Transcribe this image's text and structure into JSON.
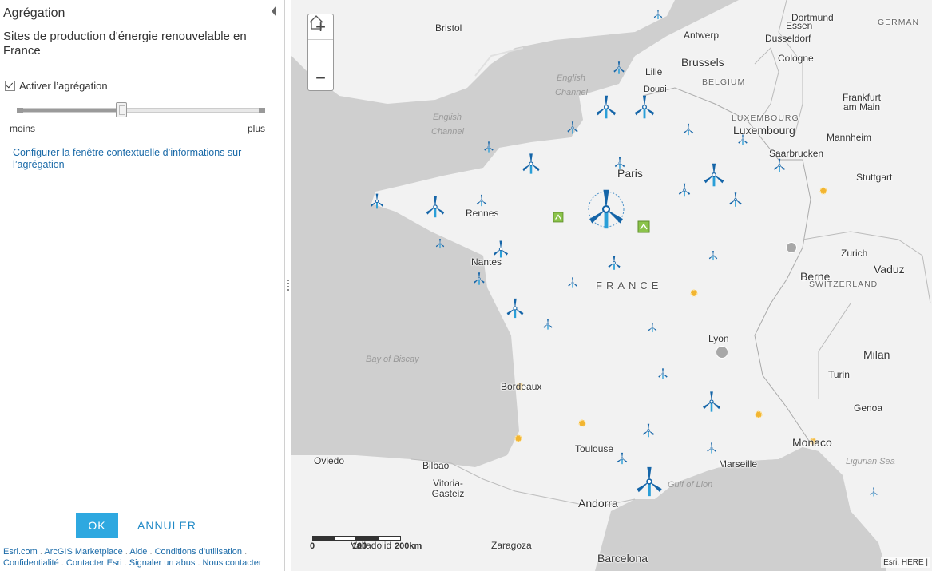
{
  "panel": {
    "title": "Agrégation",
    "layer_title": "Sites de production d'énergie renouvelable en France",
    "checkbox_label": "Activer l’agrégation",
    "slider": {
      "min_label": "moins",
      "max_label": "plus",
      "level": 0.42
    },
    "config_link": "Configurer la fenêtre contextuelle d’informations sur l’agrégation",
    "ok_label": "OK",
    "cancel_label": "ANNULER",
    "footer": {
      "links": [
        "Esri.com",
        "ArcGIS Marketplace",
        "Aide",
        "Conditions d’utilisation",
        "Confidentialité",
        "Contacter Esri",
        "Signaler un abus",
        "Nous contacter"
      ]
    }
  },
  "map": {
    "zoom_in": "+",
    "home_icon": "home-icon",
    "zoom_out": "−",
    "attribution": "Esri, HERE |",
    "scale": {
      "zero": "0",
      "mid": "100",
      "max": "200km"
    },
    "labels": {
      "bristol": "Bristol",
      "antwerp": "Antwerp",
      "dortmund": "Dortmund",
      "essen": "Essen",
      "dusseldorf": "Dusseldorf",
      "germany": "GERMAN",
      "brussels": "Brussels",
      "cologne": "Cologne",
      "lille": "Lille",
      "douai": "Douai",
      "belgium": "BELGIUM",
      "english_channel_1": "English Channel",
      "english_channel_2": "English Channel",
      "luxembourg_country": "LUXEMBOURG",
      "luxembourg": "Luxembourg",
      "frankfurt": "Frankfurt am Main",
      "mannheim": "Mannheim",
      "saarbrucken": "Saarbrucken",
      "stuttgart": "Stuttgart",
      "paris": "Paris",
      "rennes": "Rennes",
      "nantes": "Nantes",
      "zurich": "Zurich",
      "vaduz": "Vaduz",
      "berne": "Berne",
      "switzerland": "SWITZERLAND",
      "france": "FRANCE",
      "lyon": "Lyon",
      "milan": "Milan",
      "bay_of_biscay": "Bay of Biscay",
      "turin": "Turin",
      "bordeaux": "Bordeaux",
      "genoa": "Genoa",
      "toulouse": "Toulouse",
      "monaco": "Monaco",
      "oviedo": "Oviedo",
      "bilbao": "Bilbao",
      "marseille": "Marseille",
      "ligurian_sea": "Ligurian Sea",
      "vitoria": "Vitoria-Gasteiz",
      "gulf_of_lion": "Gulf of Lion",
      "andorra": "Andorra",
      "valladolid": "Valladolid",
      "zaragoza": "Zaragoza",
      "barcelona": "Barcelona"
    },
    "colors": {
      "sea": "#cfcfcf",
      "land": "#f2f2f2",
      "turbine": "#1565a8",
      "solar": "#f2b531",
      "biomass": "#8bc34a",
      "cluster": "#a8a8a8"
    }
  }
}
